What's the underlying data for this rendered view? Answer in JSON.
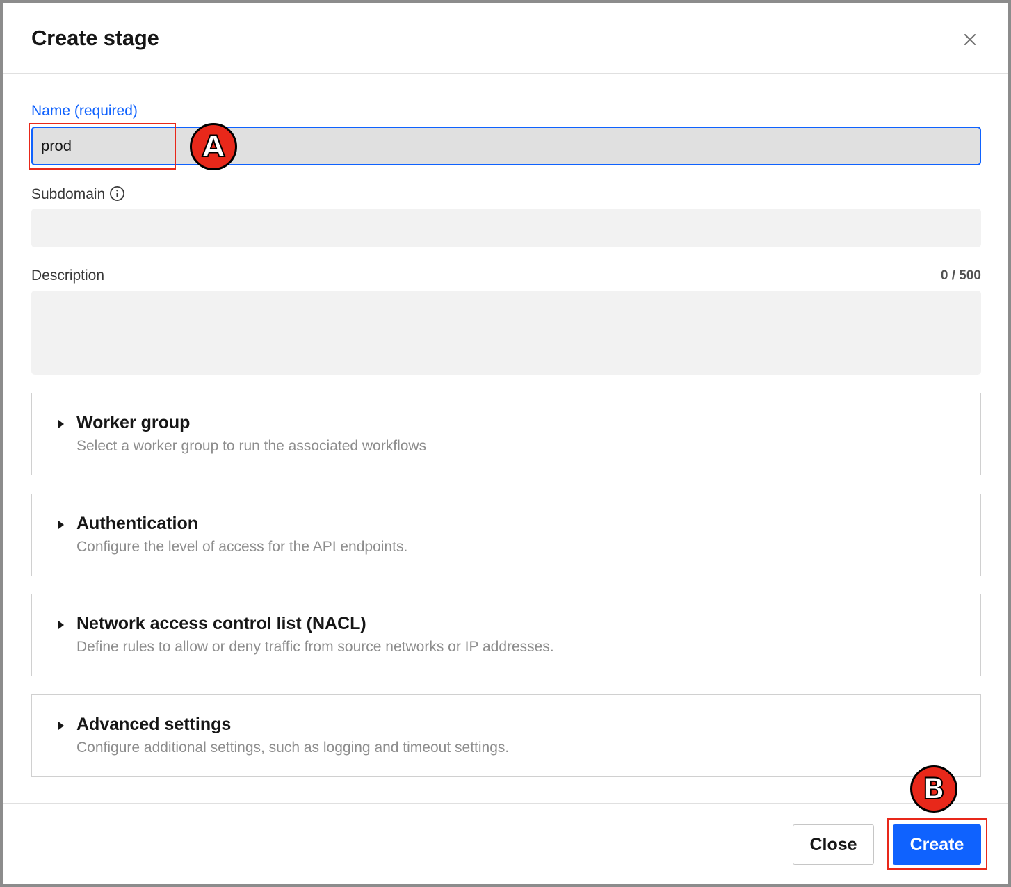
{
  "dialog": {
    "title": "Create stage",
    "close_icon": "close-icon"
  },
  "form": {
    "name": {
      "label": "Name (required)",
      "value": "prod"
    },
    "subdomain": {
      "label": "Subdomain",
      "value": "",
      "icon": "info-icon"
    },
    "description": {
      "label": "Description",
      "counter": "0 / 500",
      "value": ""
    }
  },
  "sections": [
    {
      "title": "Worker group",
      "subtitle": "Select a worker group to run the associated workflows"
    },
    {
      "title": "Authentication",
      "subtitle": "Configure the level of access for the API endpoints."
    },
    {
      "title": "Network access control list (NACL)",
      "subtitle": "Define rules to allow or deny traffic from source networks or IP addresses."
    },
    {
      "title": "Advanced settings",
      "subtitle": "Configure additional settings, such as logging and timeout settings."
    }
  ],
  "footer": {
    "close_label": "Close",
    "create_label": "Create"
  },
  "annotations": {
    "marker_a": "A",
    "marker_b": "B"
  },
  "colors": {
    "primary": "#0f62fe",
    "annotation_red": "#e8281a",
    "input_active_bg": "#e0e0e0",
    "input_bg": "#f2f2f2"
  }
}
